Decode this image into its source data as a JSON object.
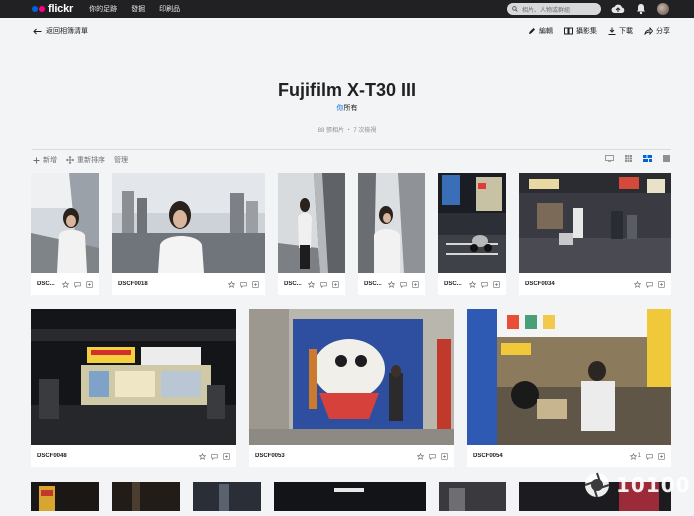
{
  "topbar": {
    "logo_text": "flickr",
    "nav": [
      "你的足跡",
      "發掘",
      "印刷品"
    ],
    "search_placeholder": "相片、人物或群組"
  },
  "subbar": {
    "back_label": "返回相簿清單",
    "actions": [
      "編輯",
      "攝影集",
      "下載",
      "分享"
    ]
  },
  "album": {
    "title": "Fujifilm X-T30 III",
    "owner_you": "你",
    "owner_rest": "所有",
    "stats": "88 張相片 ・ 7 次檢視"
  },
  "toolbar": {
    "add": "新增",
    "reorder": "重新排序",
    "manage": "管理"
  },
  "photos": [
    {
      "name": "DSC...",
      "faves": ""
    },
    {
      "name": "DSCF0018",
      "faves": ""
    },
    {
      "name": "DSC...",
      "faves": ""
    },
    {
      "name": "DSC...",
      "faves": ""
    },
    {
      "name": "DSC...",
      "faves": ""
    },
    {
      "name": "DSCF0034",
      "faves": ""
    },
    {
      "name": "DSCF0048",
      "faves": ""
    },
    {
      "name": "DSCF0053",
      "faves": ""
    },
    {
      "name": "DSCF0054",
      "faves": "1"
    }
  ],
  "watermark": {
    "text": "10100"
  },
  "colors": {
    "topbar": "#212124",
    "brand_blue": "#0063dc",
    "brand_pink": "#ff0084",
    "link": "#006add",
    "active_view": "#0063dc"
  }
}
